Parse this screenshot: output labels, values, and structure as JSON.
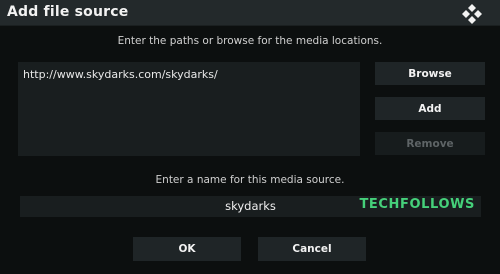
{
  "dialog": {
    "title": "Add file source",
    "logo_icon": "kodi-logo-icon",
    "paths_hint": "Enter the paths or browse for the media locations.",
    "paths": [
      "http://www.skydarks.com/skydarks/"
    ],
    "buttons": {
      "browse": "Browse",
      "add": "Add",
      "remove": "Remove"
    },
    "name_hint": "Enter a name for this media source.",
    "name_value": "skydarks",
    "ok": "OK",
    "cancel": "Cancel"
  },
  "watermark": "TECHFOLLOWS",
  "colors": {
    "background": "#0c0f0f",
    "titlebar": "#23292b",
    "panel": "#191e1f",
    "button": "#1f2527",
    "disabled_text": "#5e6466",
    "watermark": "#45d07a"
  }
}
